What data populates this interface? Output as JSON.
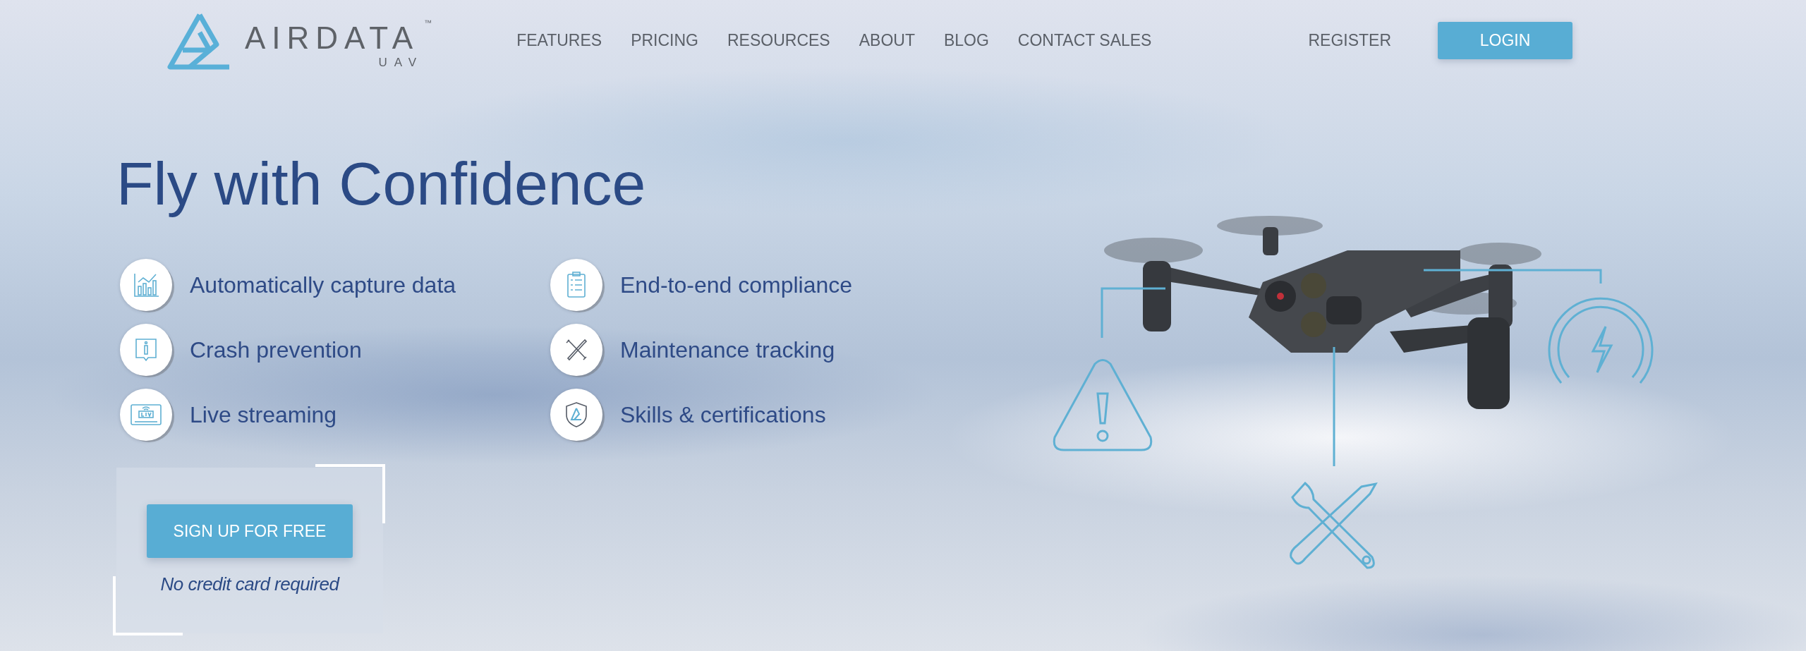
{
  "logo": {
    "wordmark": "AIRDATA",
    "trademark": "™",
    "subtitle": "UAV"
  },
  "nav": {
    "links": [
      "FEATURES",
      "PRICING",
      "RESOURCES",
      "ABOUT",
      "BLOG",
      "CONTACT SALES"
    ],
    "register": "REGISTER",
    "login": "LOGIN"
  },
  "hero": {
    "headline": "Fly with Confidence",
    "features": [
      {
        "label": "Automatically capture data",
        "kind": "chart"
      },
      {
        "label": "End-to-end compliance",
        "kind": "clipboard"
      },
      {
        "label": "Crash prevention",
        "kind": "info"
      },
      {
        "label": "Maintenance tracking",
        "kind": "tools"
      },
      {
        "label": "Live streaming",
        "kind": "monitor"
      },
      {
        "label": "Skills & certifications",
        "kind": "shield"
      }
    ],
    "cta": {
      "button": "SIGN UP FOR FREE",
      "note": "No credit card required"
    }
  }
}
